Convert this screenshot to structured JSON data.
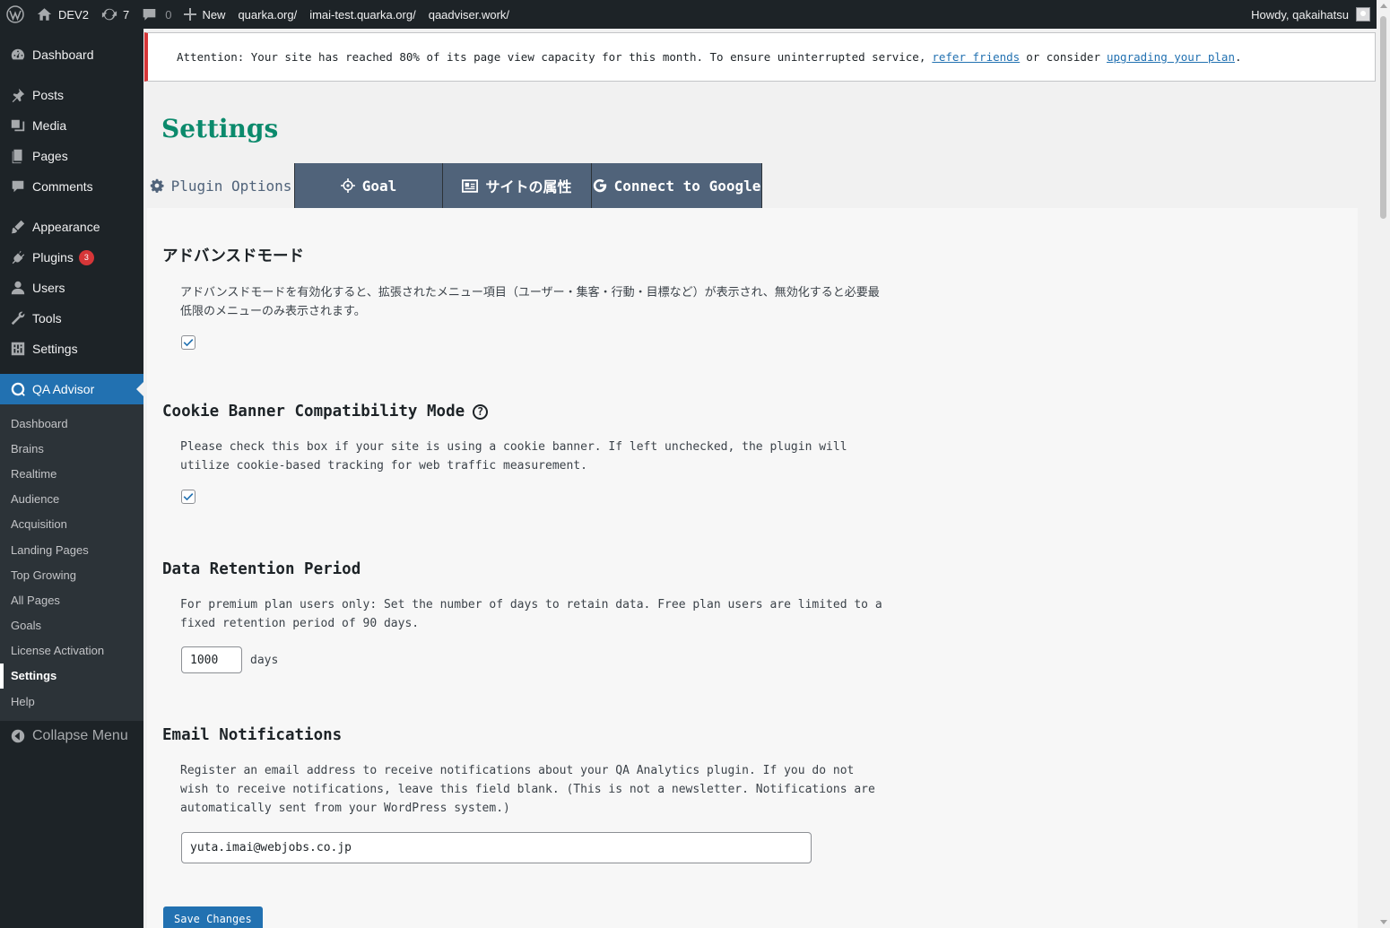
{
  "admin_bar": {
    "site_name": "DEV2",
    "updates_count": "7",
    "comments_count": "0",
    "new_label": "New",
    "links": [
      "quarka.org/",
      "imai-test.quarka.org/",
      "qaadviser.work/"
    ],
    "howdy": "Howdy, qakaihatsu"
  },
  "sidebar": {
    "items": [
      {
        "label": "Dashboard",
        "icon": "dashboard-icon"
      },
      {
        "label": "Posts",
        "icon": "pin-icon"
      },
      {
        "label": "Media",
        "icon": "media-icon"
      },
      {
        "label": "Pages",
        "icon": "pages-icon"
      },
      {
        "label": "Comments",
        "icon": "comments-icon"
      },
      {
        "label": "Appearance",
        "icon": "appearance-icon"
      },
      {
        "label": "Plugins",
        "icon": "plugins-icon",
        "badge": "3"
      },
      {
        "label": "Users",
        "icon": "users-icon"
      },
      {
        "label": "Tools",
        "icon": "tools-icon"
      },
      {
        "label": "Settings",
        "icon": "settings-icon"
      },
      {
        "label": "QA Advisor",
        "icon": "qa-icon"
      }
    ],
    "submenu": [
      "Dashboard",
      "Brains",
      "Realtime",
      "Audience",
      "Acquisition",
      "Landing Pages",
      "Top Growing",
      "All Pages",
      "Goals",
      "License Activation",
      "Settings",
      "Help"
    ],
    "collapse_label": "Collapse Menu"
  },
  "notice": {
    "text_before": "Attention: Your site has reached 80% of its page view capacity for this month. To ensure uninterrupted service,",
    "link1": "refer friends",
    "text_mid": "or consider",
    "link2": "upgrading your plan",
    "text_end": "."
  },
  "page": {
    "title": "Settings",
    "tabs": [
      "Plugin Options",
      "Goal",
      "サイトの属性",
      "Connect to Google"
    ]
  },
  "sections": {
    "advanced": {
      "title": "アドバンスドモード",
      "desc": "アドバンスドモードを有効化すると、拡張されたメニュー項目（ユーザー・集客・行動・目標など）が表示され、無効化すると必要最低限のメニューのみ表示されます。",
      "checked": true
    },
    "cookie": {
      "title": "Cookie Banner Compatibility Mode",
      "help": "?",
      "desc": "Please check this box if your site is using a cookie banner. If left unchecked, the plugin will utilize cookie-based tracking for web traffic measurement.",
      "checked": true
    },
    "retention": {
      "title": "Data Retention Period",
      "desc": "For premium plan users only: Set the number of days to retain data. Free plan users are limited to a fixed retention period of 90 days.",
      "value": "1000",
      "unit": "days"
    },
    "email": {
      "title": "Email Notifications",
      "desc": "Register an email address to receive notifications about your QA Analytics plugin. If you do not wish to receive notifications, leave this field blank. (This is not a newsletter. Notifications are automatically sent from your WordPress system.)",
      "value": "yuta.imai@webjobs.co.jp"
    }
  },
  "save_label": "Save Changes",
  "colors": {
    "accent": "#2271b1",
    "title_green": "#0b8a6c",
    "tab_bg": "#50637a",
    "notice_red": "#d63638"
  }
}
